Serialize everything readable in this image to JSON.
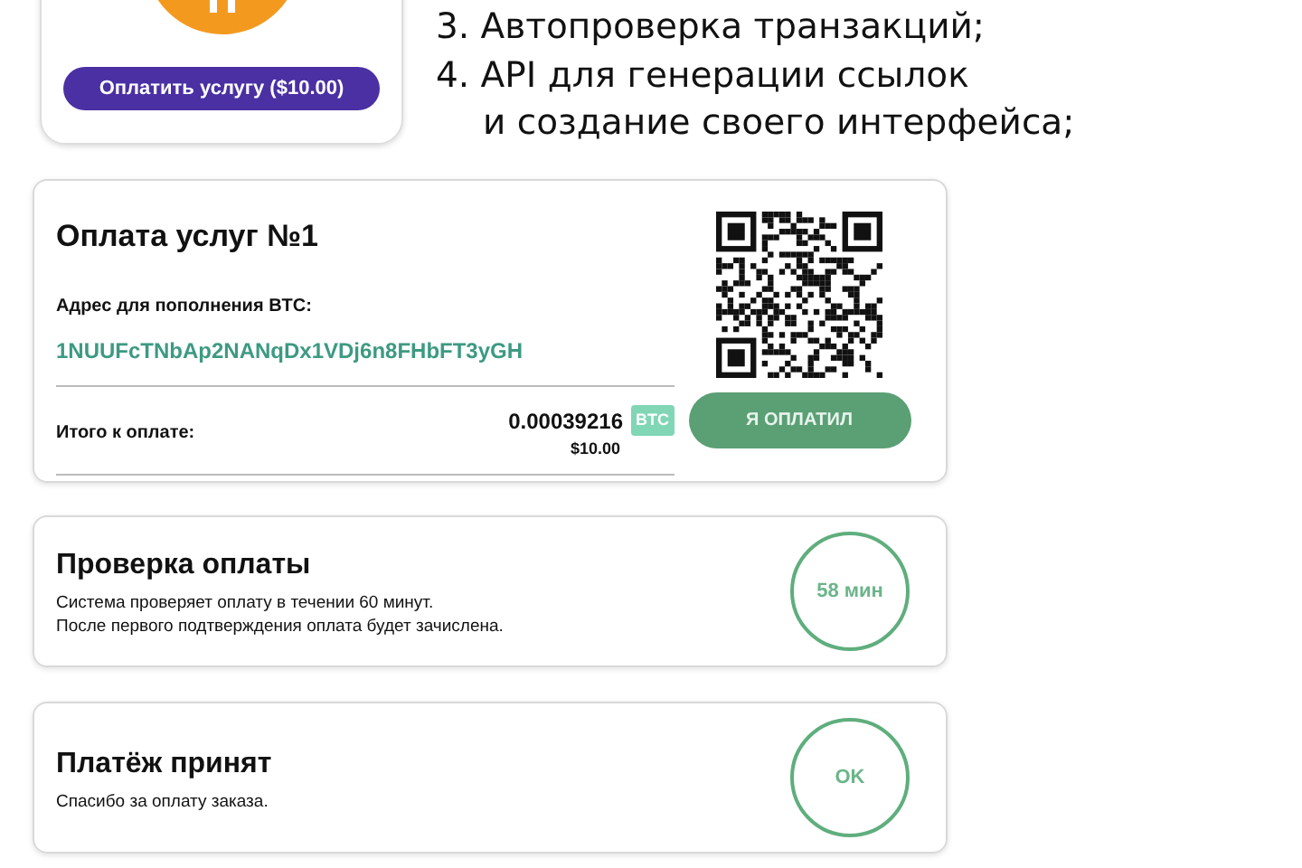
{
  "pay_card": {
    "button": "Оплатить услугу ($10.00)"
  },
  "features": [
    {
      "text": "3. Автопроверка транзакций;"
    },
    {
      "text": "4. API для генерации ссылок",
      "continuation": "и создание своего интерфейса;"
    }
  ],
  "invoice": {
    "title": "Оплата услуг №1",
    "address_label": "Адрес для пополнения BTC:",
    "address": "1NUUFcTNbAp2NANqDx1VDj6n8FHbFT3yGH",
    "total_label": "Итого к оплате:",
    "amount": "0.00039216",
    "currency": "BTC",
    "usd": "$10.00",
    "button": "Я ОПЛАТИЛ"
  },
  "status_cards": [
    {
      "title": "Проверка оплаты",
      "lines": [
        "Система проверяет оплату в течении 60 минут.",
        "После первого подтверждения оплата будет зачислена."
      ],
      "badge": "58 мин"
    },
    {
      "title": "Платёж принят",
      "lines": [
        "Спасибо за оплату заказа."
      ],
      "badge": "OK"
    }
  ]
}
